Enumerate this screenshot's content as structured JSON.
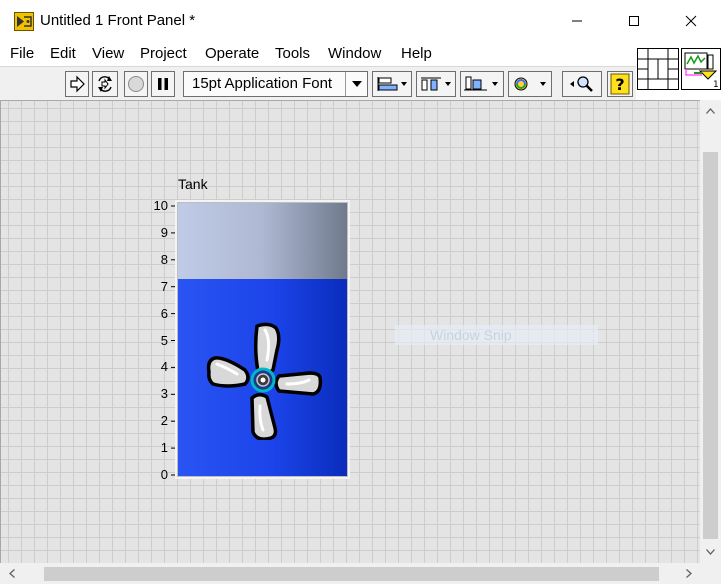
{
  "window": {
    "title": "Untitled 1 Front Panel *"
  },
  "menu": [
    "File",
    "Edit",
    "View",
    "Project",
    "Operate",
    "Tools",
    "Window",
    "Help"
  ],
  "toolbar": {
    "font": "15pt Application Font"
  },
  "tank": {
    "label": "Tank",
    "scale": [
      "10",
      "9",
      "8",
      "7",
      "6",
      "5",
      "4",
      "3",
      "2",
      "1",
      "0"
    ],
    "value": 7.2,
    "max": 10
  },
  "overlay": {
    "snip": "Window Snip"
  },
  "colors": {
    "fill": "#1c44ea",
    "empty": "#aeb8d2",
    "grid": "#cdcdcd",
    "panel": "#e4e4e4"
  }
}
